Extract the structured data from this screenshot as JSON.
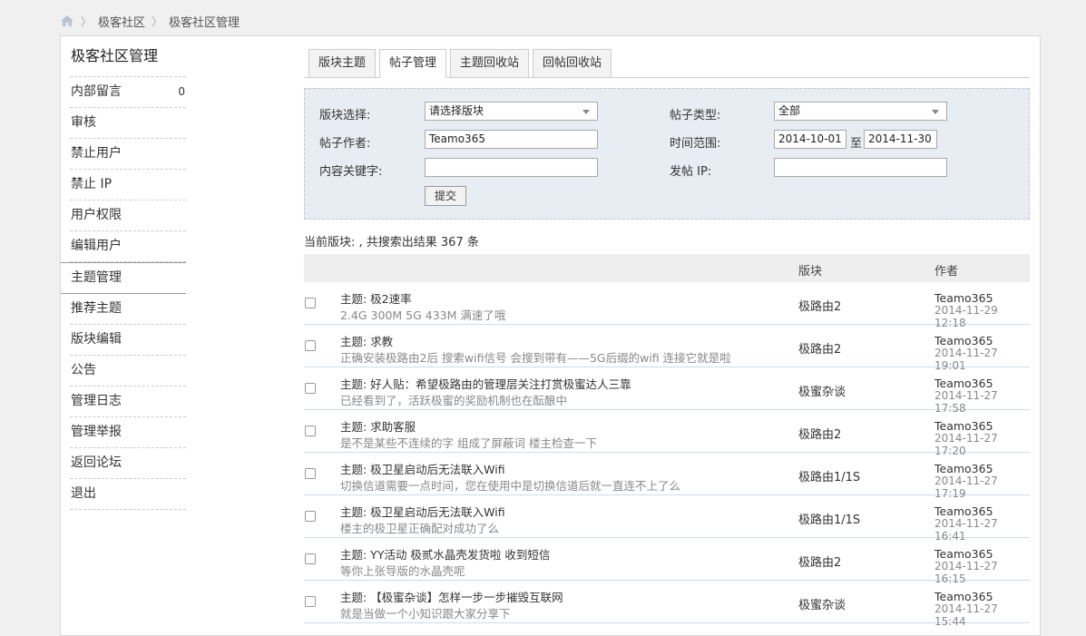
{
  "breadcrumb": {
    "items": [
      "极客社区",
      "极客社区管理"
    ]
  },
  "sidebar": {
    "title": "极客社区管理",
    "items": [
      {
        "label": "内部留言",
        "count": "0"
      },
      {
        "label": "审核"
      },
      {
        "label": "禁止用户"
      },
      {
        "label": "禁止 IP"
      },
      {
        "label": "用户权限"
      },
      {
        "label": "编辑用户"
      },
      {
        "label": "主题管理"
      },
      {
        "label": "推荐主题"
      },
      {
        "label": "版块编辑"
      },
      {
        "label": "公告"
      },
      {
        "label": "管理日志"
      },
      {
        "label": "管理举报"
      },
      {
        "label": "返回论坛"
      },
      {
        "label": "退出"
      }
    ]
  },
  "tabs": [
    "版块主题",
    "帖子管理",
    "主题回收站",
    "回帖回收站"
  ],
  "filter": {
    "board_label": "版块选择:",
    "board_value": "请选择版块",
    "type_label": "帖子类型:",
    "type_value": "全部",
    "author_label": "帖子作者:",
    "author_value": "Teamo365",
    "time_label": "时间范围:",
    "time_from": "2014-10-01",
    "time_sep": "至",
    "time_to": "2014-11-30",
    "keyword_label": "内容关键字:",
    "keyword_value": "",
    "ip_label": "发帖 IP:",
    "ip_value": "",
    "submit": "提交"
  },
  "summary": "当前版块: , 共搜索出结果 367 条",
  "table": {
    "col_board": "版块",
    "col_author": "作者",
    "rows": [
      {
        "title": "主题: 极2速率",
        "content": "2.4G 300M 5G 433M 满速了哦",
        "board": "极路由2",
        "author": "Teamo365",
        "time": "2014-11-29 12:18"
      },
      {
        "title": "主题: 求教",
        "content": "正确安装极路由2后 搜索wifi信号 会搜到带有——5G后缀的wifi 连接它就是啦",
        "board": "极路由2",
        "author": "Teamo365",
        "time": "2014-11-27 19:01"
      },
      {
        "title": "主题: 好人贴：希望极路由的管理层关注打赏极蜜达人三靠",
        "content": "已经看到了，活跃极蜜的奖励机制也在酝酿中",
        "board": "极蜜杂谈",
        "author": "Teamo365",
        "time": "2014-11-27 17:58"
      },
      {
        "title": "主题: 求助客服",
        "content": "是不是某些不连续的字 组成了屏蔽词 楼主检查一下",
        "board": "极路由2",
        "author": "Teamo365",
        "time": "2014-11-27 17:20"
      },
      {
        "title": "主题: 极卫星启动后无法联入Wifi",
        "content": "切换信道需要一点时间，您在使用中是切换信道后就一直连不上了么",
        "board": "极路由1/1S",
        "author": "Teamo365",
        "time": "2014-11-27 17:19"
      },
      {
        "title": "主题: 极卫星启动后无法联入Wifi",
        "content": "楼主的极卫星正确配对成功了么",
        "board": "极路由1/1S",
        "author": "Teamo365",
        "time": "2014-11-27 16:41"
      },
      {
        "title": "主题: YY活动 极贰水晶壳发货啦 收到短信",
        "content": "等你上张导版的水晶壳呢",
        "board": "极路由2",
        "author": "Teamo365",
        "time": "2014-11-27 16:15"
      },
      {
        "title": "主题: 【极蜜杂谈】怎样一步一步摧毁互联网",
        "content": "就是当做一个小知识跟大家分享下",
        "board": "极蜜杂谈",
        "author": "Teamo365",
        "time": "2014-11-27 15:44"
      }
    ]
  }
}
